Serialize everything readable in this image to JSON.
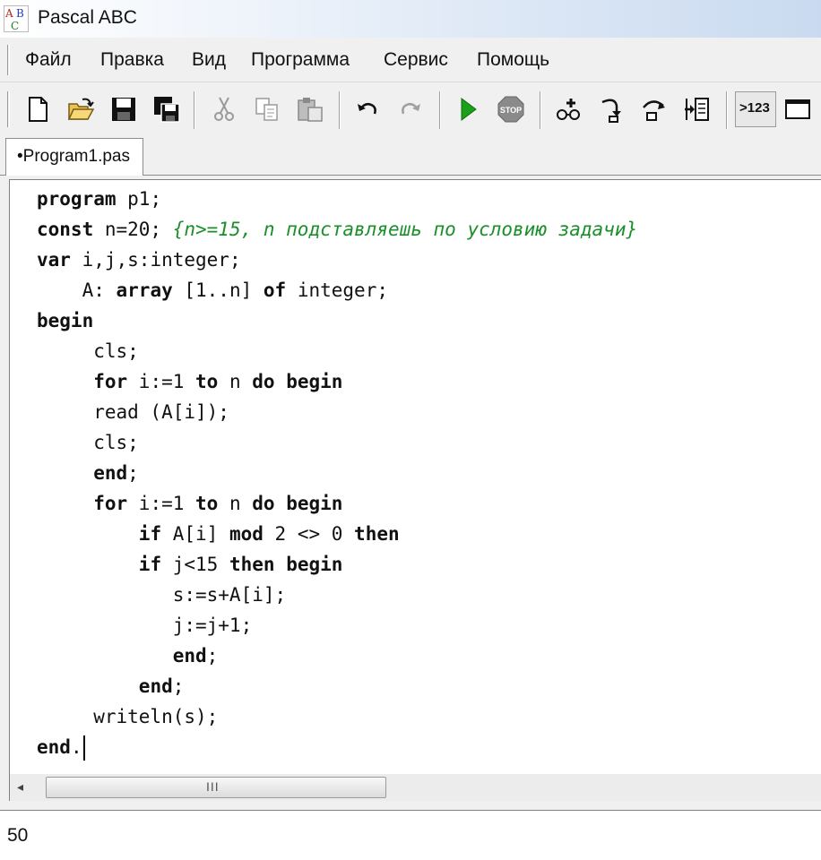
{
  "window": {
    "title": "Pascal ABC",
    "logo": [
      "A",
      "B",
      "C"
    ]
  },
  "menu": [
    "Файл",
    "Правка",
    "Вид",
    "Программа",
    "Сервис",
    "Помощь"
  ],
  "toolbar": {
    "icons": [
      "new-file-icon",
      "open-folder-icon",
      "save-icon",
      "save-all-icon",
      "cut-icon",
      "copy-icon",
      "paste-icon",
      "undo-icon",
      "redo-icon",
      "run-icon",
      "stop-icon",
      "watch-icon",
      "step-into-icon",
      "step-over-icon",
      "evaluate-icon",
      "output-mode-icon",
      "window-icon"
    ],
    "output_mode_label": ">123"
  },
  "tab": {
    "label": "•Program1.pas"
  },
  "code": [
    [
      {
        "t": "program",
        "k": "kw"
      },
      {
        "t": " p1;"
      }
    ],
    [
      {
        "t": "const",
        "k": "kw"
      },
      {
        "t": " n=20; "
      },
      {
        "t": "{n>=15, n подставляешь по условию задачи}",
        "k": "cm"
      }
    ],
    [
      {
        "t": "var",
        "k": "kw"
      },
      {
        "t": " i,j,s:integer;"
      }
    ],
    [
      {
        "t": "    A: "
      },
      {
        "t": "array",
        "k": "kw"
      },
      {
        "t": " [1..n] "
      },
      {
        "t": "of",
        "k": "kw"
      },
      {
        "t": " integer;"
      }
    ],
    [
      {
        "t": "begin",
        "k": "kw"
      }
    ],
    [
      {
        "t": "     cls;"
      }
    ],
    [
      {
        "t": "     "
      },
      {
        "t": "for",
        "k": "kw"
      },
      {
        "t": " i:=1 "
      },
      {
        "t": "to",
        "k": "kw"
      },
      {
        "t": " n "
      },
      {
        "t": "do",
        "k": "kw"
      },
      {
        "t": " "
      },
      {
        "t": "begin",
        "k": "kw"
      }
    ],
    [
      {
        "t": "     read (A[i]);"
      }
    ],
    [
      {
        "t": "     cls;"
      }
    ],
    [
      {
        "t": "     "
      },
      {
        "t": "end",
        "k": "kw"
      },
      {
        "t": ";"
      }
    ],
    [
      {
        "t": "     "
      },
      {
        "t": "for",
        "k": "kw"
      },
      {
        "t": " i:=1 "
      },
      {
        "t": "to",
        "k": "kw"
      },
      {
        "t": " n "
      },
      {
        "t": "do",
        "k": "kw"
      },
      {
        "t": " "
      },
      {
        "t": "begin",
        "k": "kw"
      }
    ],
    [
      {
        "t": "         "
      },
      {
        "t": "if",
        "k": "kw"
      },
      {
        "t": " A[i] "
      },
      {
        "t": "mod",
        "k": "kw"
      },
      {
        "t": " 2 <> 0 "
      },
      {
        "t": "then",
        "k": "kw"
      }
    ],
    [
      {
        "t": "         "
      },
      {
        "t": "if",
        "k": "kw"
      },
      {
        "t": " j<15 "
      },
      {
        "t": "then",
        "k": "kw"
      },
      {
        "t": " "
      },
      {
        "t": "begin",
        "k": "kw"
      }
    ],
    [
      {
        "t": "            s:=s+A[i];"
      }
    ],
    [
      {
        "t": "            j:=j+1;"
      }
    ],
    [
      {
        "t": "            "
      },
      {
        "t": "end",
        "k": "kw"
      },
      {
        "t": ";"
      }
    ],
    [
      {
        "t": "         "
      },
      {
        "t": "end",
        "k": "kw"
      },
      {
        "t": ";"
      }
    ],
    [
      {
        "t": "     writeln(s);"
      }
    ],
    [
      {
        "t": "end",
        "k": "kw"
      },
      {
        "t": "."
      }
    ]
  ],
  "scrollbar": {
    "left_arrow": "◂",
    "grip": "III"
  },
  "output": {
    "text": "50"
  },
  "colors": {
    "comment": "#1a8f2a",
    "run": "#1aa01a",
    "stop": "#888888"
  }
}
